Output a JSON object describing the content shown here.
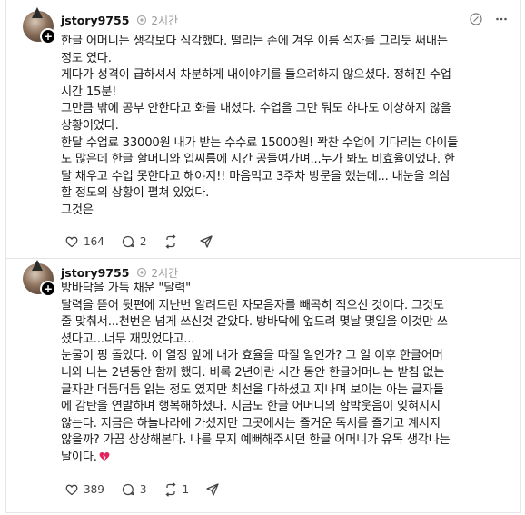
{
  "posts": [
    {
      "username": "jstory9755",
      "time": "2시간",
      "lines": [
        "한글 어머니는 생각보다 심각했다. 떨리는 손에 겨우 이름 석자를 그리듯 써내는",
        "정도 였다.",
        "게다가 성격이 급하셔서 차분하게 내이야기를 들으려하지 않으셨다. 정해진 수업",
        "시간 15분!",
        "그만큼 밖에 공부 안한다고 화를 내셨다. 수업을 그만 둬도 하나도 이상하지 않을",
        "상황이었다.",
        "한달 수업료 33000원 내가 받는 수수료 15000원! 꽉찬 수업에 기다리는 아이들",
        "도 많은데 한글 할머니와 입씨름에 시간 공들여가며...누가 봐도 비효율이었다. 한",
        "달 채우고 수업 못한다고 해야지!! 마음먹고 3주차 방문을 했는데... 내눈을 의심",
        "할 정도의 상황이 펼쳐 있었다.",
        "그것은"
      ],
      "likes": "164",
      "comments": "2",
      "reposts": "",
      "shares": ""
    },
    {
      "username": "jstory9755",
      "time": "2시간",
      "lines": [
        "방바닥을 가득 채운 \"달력\"",
        "달력을 뜯어 뒷편에 지난번 알려드린 자모음자를 빼곡히 적으신 것이다. 그것도",
        "줄 맞춰서...천번은 넘게 쓰신것 같았다. 방바닥에 엎드려 몇날 몇일을 이것만 쓰",
        "셨다고...너무 재밌었다고...",
        "눈물이 핑 돌았다. 이 열정 앞에 내가 효율을 따질 일인가? 그 일 이후 한글어머",
        "니와 나는 2년동안 함께 했다. 비록 2년이란 시간 동안 한글어머니는 받침 없는",
        "글자만 더듬더듬 읽는 정도 였지만 최선을 다하셨고 지나며 보이는 아는 글자들",
        "에 감탄을 연발하며 행복해하셨다. 지금도 한글 어머니의 함박웃음이 잊혀지지",
        "않는다. 지금은 하늘나라에 가셨지만 그곳에서는 즐거운 독서를 즐기고 계시지",
        "않을까? 가끔 상상해본다. 나를 무지 예뻐해주시던 한글 어머니가 유독 생각나는",
        "날이다."
      ],
      "likes": "389",
      "comments": "3",
      "reposts": "1",
      "shares": ""
    }
  ],
  "colors": {
    "text": "#1a1a1a",
    "muted": "#999999",
    "heart": "#e0245e"
  },
  "icons": {
    "repost": "repost-icon",
    "edit": "edit-icon",
    "more": "more-icon",
    "like": "heart-icon",
    "comment": "comment-icon",
    "repost_action": "repost-action-icon",
    "share": "share-icon"
  }
}
